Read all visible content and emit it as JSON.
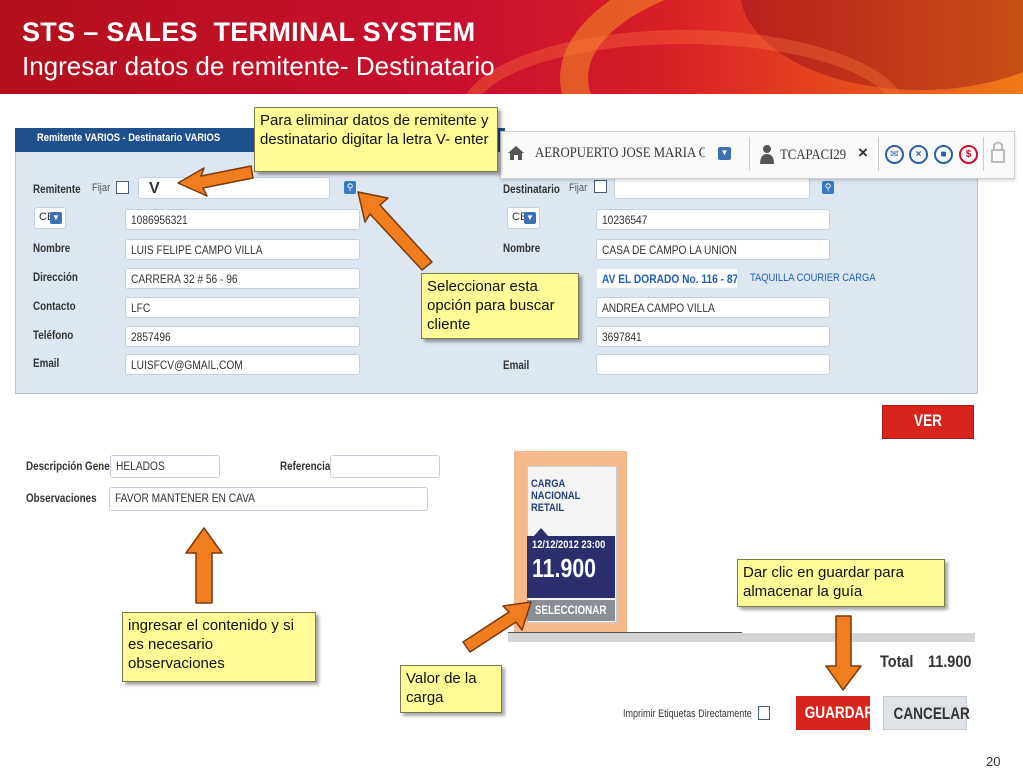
{
  "slide": {
    "title": "STS – SALES  TERMINAL SYSTEM",
    "subtitle": "Ingresar datos de remitente- Destinatario",
    "page_number": "20"
  },
  "topbar": {
    "location": "AEROPUERTO JOSE MARIA C",
    "user": "TCAPACI29",
    "close": "×"
  },
  "panel": {
    "header": "Remitente VARIOS - Destinatario VARIOS"
  },
  "remitente": {
    "label": "Remitente",
    "fijar": "Fijar",
    "search_value": "V",
    "doc_type": "CE",
    "doc_number": "1086956321",
    "labels": {
      "nombre": "Nombre",
      "direccion": "Dirección",
      "contacto": "Contacto",
      "telefono": "Teléfono",
      "email": "Email"
    },
    "nombre": "LUIS FELIPE CAMPO VILLA",
    "direccion": "CARRERA 32 # 56 - 96",
    "contacto": "LFC",
    "telefono": "2857496",
    "email": "LUISFCV@GMAIL.COM"
  },
  "destinatario": {
    "label": "Destinatario",
    "fijar": "Fijar",
    "doc_type": "CE",
    "doc_number": "10236547",
    "labels": {
      "nombre": "Nombre",
      "email": "Email"
    },
    "nombre": "CASA DE CAMPO LA UNION",
    "direccion": "AV EL DORADO No. 116 - 87",
    "taquilla": "TAQUILLA COURIER CARGA",
    "contacto": "ANDREA CAMPO VILLA",
    "telefono": "3697841"
  },
  "shipment": {
    "descripcion_label": "Descripción General",
    "descripcion": "HELADOS",
    "referencia_label": "Referencia",
    "observaciones_label": "Observaciones",
    "observaciones": "FAVOR MANTENER EN CAVA"
  },
  "price_card": {
    "line1": "CARGA",
    "line2": "NACIONAL",
    "line3": "RETAIL",
    "date": "12/12/2012 23:00",
    "price": "11.900",
    "select": "SELECCIONAR"
  },
  "buttons": {
    "ver_precio": "VER PRECIO",
    "guardar": "GUARDAR",
    "cancelar": "CANCELAR"
  },
  "total": {
    "label": "Total",
    "value": "11.900"
  },
  "imprimir_label": "Imprimir Etiquetas Directamente",
  "callouts": {
    "eliminar": "Para eliminar datos de remitente y destinatario digitar la letra V- enter",
    "buscar": "Seleccionar esta opción para buscar cliente",
    "contenido": "ingresar el contenido y si es necesario observaciones",
    "valor": "Valor de la carga",
    "guardar": "Dar clic en guardar para almacenar la guía"
  },
  "colors": {
    "header_red": "#c8102e",
    "panel_blue": "#dde7f2",
    "button_red": "#d9241c",
    "button_gray": "#dfe3e8",
    "callout_yellow": "#fffb96",
    "arrow_orange": "#f07d1e",
    "card_navy": "#2c2f6e"
  }
}
